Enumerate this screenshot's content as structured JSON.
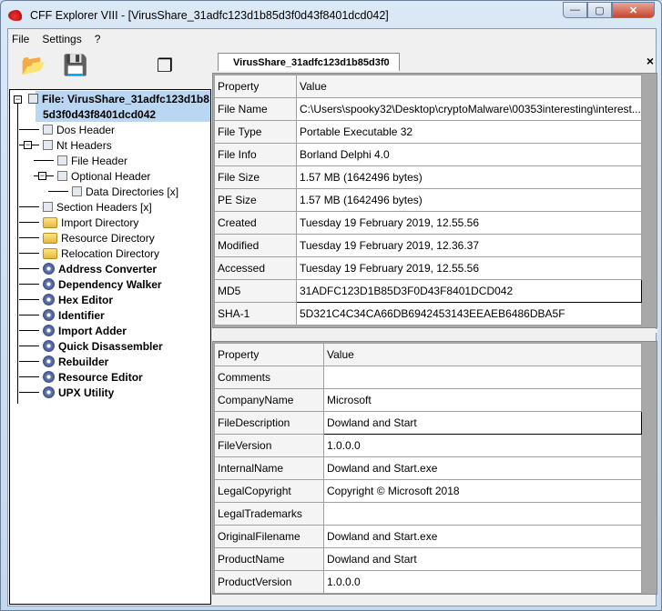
{
  "window": {
    "title": "CFF Explorer VIII - [VirusShare_31adfc123d1b85d3f0d43f8401dcd042]",
    "minimize": "—",
    "maximize": "▢",
    "close": "✕"
  },
  "menu": [
    "File",
    "Settings",
    "?"
  ],
  "toolbar": [
    {
      "icon": "open-folder-icon"
    },
    {
      "icon": "save-disk-icon"
    },
    {
      "icon": "windows-icon"
    }
  ],
  "tree": {
    "root": "File: VirusShare_31adfc123d1b8",
    "root2": "5d3f0d43f8401dcd042",
    "items": [
      "Dos Header",
      "Nt Headers",
      "File Header",
      "Optional Header",
      "Data Directories [x]",
      "Section Headers [x]",
      "Import Directory",
      "Resource Directory",
      "Relocation Directory"
    ],
    "tools": [
      "Address Converter",
      "Dependency Walker",
      "Hex Editor",
      "Identifier",
      "Import Adder",
      "Quick Disassembler",
      "Rebuilder",
      "Resource Editor",
      "UPX Utility"
    ]
  },
  "tab": {
    "label": "VirusShare_31adfc123d1b85d3f0",
    "close": "×"
  },
  "file_table": {
    "headers": [
      "Property",
      "Value"
    ],
    "rows": [
      [
        "File Name",
        "C:\\Users\\spooky32\\Desktop\\cryptoMalware\\00353interesting\\interest..."
      ],
      [
        "File Type",
        "Portable Executable 32"
      ],
      [
        "File Info",
        "Borland Delphi 4.0"
      ],
      [
        "File Size",
        "1.57 MB (1642496 bytes)"
      ],
      [
        "PE Size",
        "1.57 MB (1642496 bytes)"
      ],
      [
        "Created",
        "Tuesday 19 February 2019, 12.55.56"
      ],
      [
        "Modified",
        "Tuesday 19 February 2019, 12.36.37"
      ],
      [
        "Accessed",
        "Tuesday 19 February 2019, 12.55.56"
      ],
      [
        "MD5",
        "31ADFC123D1B85D3F0D43F8401DCD042"
      ],
      [
        "SHA-1",
        "5D321C4C34CA66DB6942453143EEAEB6486DBA5F"
      ]
    ]
  },
  "version_table": {
    "headers": [
      "Property",
      "Value"
    ],
    "rows": [
      [
        "Comments",
        ""
      ],
      [
        "CompanyName",
        "Microsoft"
      ],
      [
        "FileDescription",
        "Dowland and Start"
      ],
      [
        "FileVersion",
        "1.0.0.0"
      ],
      [
        "InternalName",
        "Dowland and Start.exe"
      ],
      [
        "LegalCopyright",
        "Copyright © Microsoft 2018"
      ],
      [
        "LegalTrademarks",
        ""
      ],
      [
        "OriginalFilename",
        "Dowland and Start.exe"
      ],
      [
        "ProductName",
        "Dowland and Start"
      ],
      [
        "ProductVersion",
        "1.0.0.0"
      ]
    ]
  }
}
